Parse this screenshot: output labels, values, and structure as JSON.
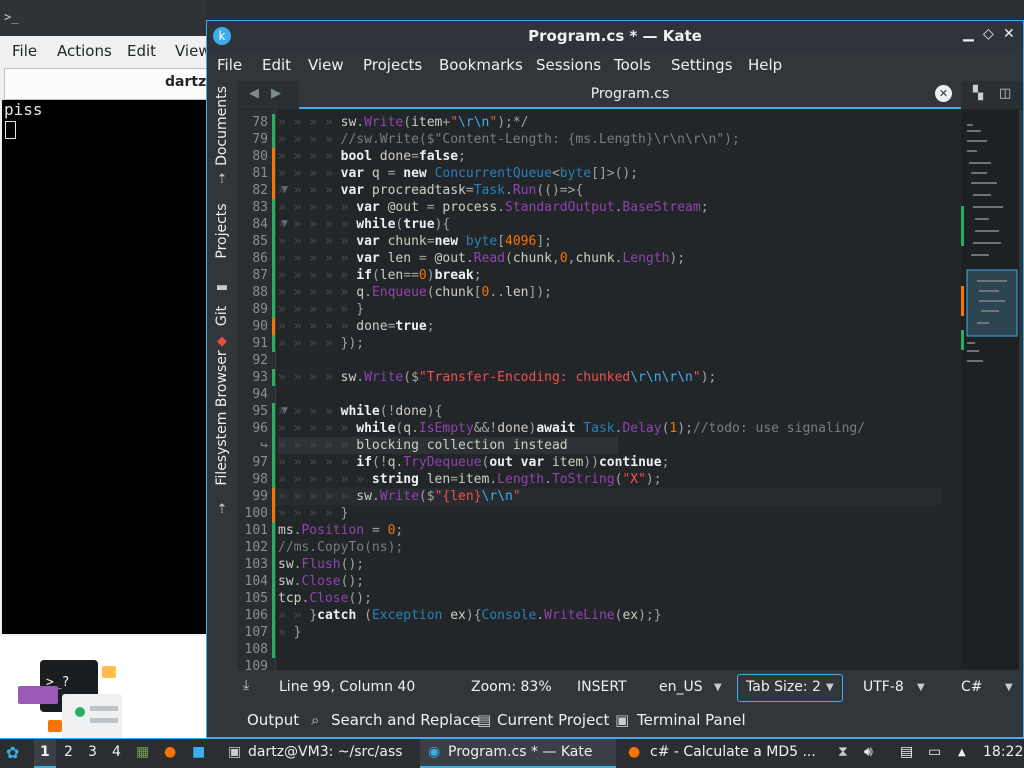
{
  "konsole": {
    "title": "dartz@VM3: ~/src/ass",
    "menu": [
      "File",
      "Actions",
      "Edit",
      "View"
    ],
    "tab_title": "dartz",
    "output": "piss"
  },
  "kate": {
    "title": "Program.cs * — Kate",
    "menu": [
      "File",
      "Edit",
      "View",
      "Projects",
      "Bookmarks",
      "Sessions",
      "Tools",
      "Settings",
      "Help"
    ],
    "side_tabs": [
      "Documents",
      "Projects",
      "Git",
      "Filesystem Browser"
    ],
    "doc_tab": "Program.cs",
    "status": {
      "position": "Line 99, Column 40",
      "zoom": "Zoom: 83%",
      "mode": "INSERT",
      "lang": "en_US",
      "tabsize": "Tab Size: 2",
      "encoding": "UTF-8",
      "syntax": "C#"
    },
    "bottom_tabs": [
      "Output",
      "Search and Replace",
      "Current Project",
      "Terminal Panel"
    ]
  },
  "code_lines": [
    {
      "n": "78",
      "t": "        sw.Write(item+\"\\r\\n\");*/"
    },
    {
      "n": "79",
      "t": "        //sw.Write($\"Content-Length: {ms.Length}\\r\\n\\r\\n\");"
    },
    {
      "n": "80",
      "t": "        bool done=false;"
    },
    {
      "n": "81",
      "t": "        var q = new ConcurrentQueue<byte[]>();"
    },
    {
      "n": "82",
      "t": "        var procreadtask=Task.Run(()=>{"
    },
    {
      "n": "83",
      "t": "          var @out = process.StandardOutput.BaseStream;"
    },
    {
      "n": "84",
      "t": "          while(true){"
    },
    {
      "n": "85",
      "t": "          var chunk=new byte[4096];"
    },
    {
      "n": "86",
      "t": "          var len = @out.Read(chunk,0,chunk.Length);"
    },
    {
      "n": "87",
      "t": "          if(len==0)break;"
    },
    {
      "n": "88",
      "t": "          q.Enqueue(chunk[0..len]);"
    },
    {
      "n": "89",
      "t": "          }"
    },
    {
      "n": "90",
      "t": "          done=true;"
    },
    {
      "n": "91",
      "t": "        });"
    },
    {
      "n": "92",
      "t": ""
    },
    {
      "n": "93",
      "t": "        sw.Write($\"Transfer-Encoding: chunked\\r\\n\\r\\n\");"
    },
    {
      "n": "94",
      "t": ""
    },
    {
      "n": "95",
      "t": "        while(!done){"
    },
    {
      "n": "96",
      "t": "          while(q.IsEmpty&&!done)await Task.Delay(1);//todo: use signaling/"
    },
    {
      "n": "",
      "t": "          blocking collection instead"
    },
    {
      "n": "97",
      "t": "          if(!q.TryDequeue(out var item))continue;"
    },
    {
      "n": "98",
      "t": "            string len=item.Length.ToString(\"X\");"
    },
    {
      "n": "99",
      "t": "          sw.Write($\"{len}\\r\\n\""
    },
    {
      "n": "100",
      "t": "        }"
    },
    {
      "n": "101",
      "t": "ms.Position = 0;"
    },
    {
      "n": "102",
      "t": "//ms.CopyTo(ns);"
    },
    {
      "n": "103",
      "t": "sw.Flush();"
    },
    {
      "n": "104",
      "t": "sw.Close();"
    },
    {
      "n": "105",
      "t": "tcp.Close();"
    },
    {
      "n": "106",
      "t": "    }catch (Exception ex){Console.WriteLine(ex);}"
    },
    {
      "n": "107",
      "t": "  }"
    },
    {
      "n": "108",
      "t": ""
    },
    {
      "n": "109",
      "t": ""
    }
  ],
  "taskbar": {
    "desktops": [
      "1",
      "2",
      "3",
      "4"
    ],
    "tasks": [
      "dartz@VM3: ~/src/ass",
      "Program.cs * — Kate",
      "c# - Calculate a MD5 ..."
    ],
    "clock": "18:22"
  },
  "colors": {
    "accent": "#3daee9",
    "window_bg": "#31363b",
    "editor_bg": "#232629",
    "modified_marker": "#f67400",
    "saved_marker": "#27ae60"
  },
  "icons": [
    "konsole-icon",
    "kate-icon",
    "kde-menu-icon",
    "firefox-icon",
    "volume-icon",
    "clipboard-icon",
    "network-icon"
  ]
}
